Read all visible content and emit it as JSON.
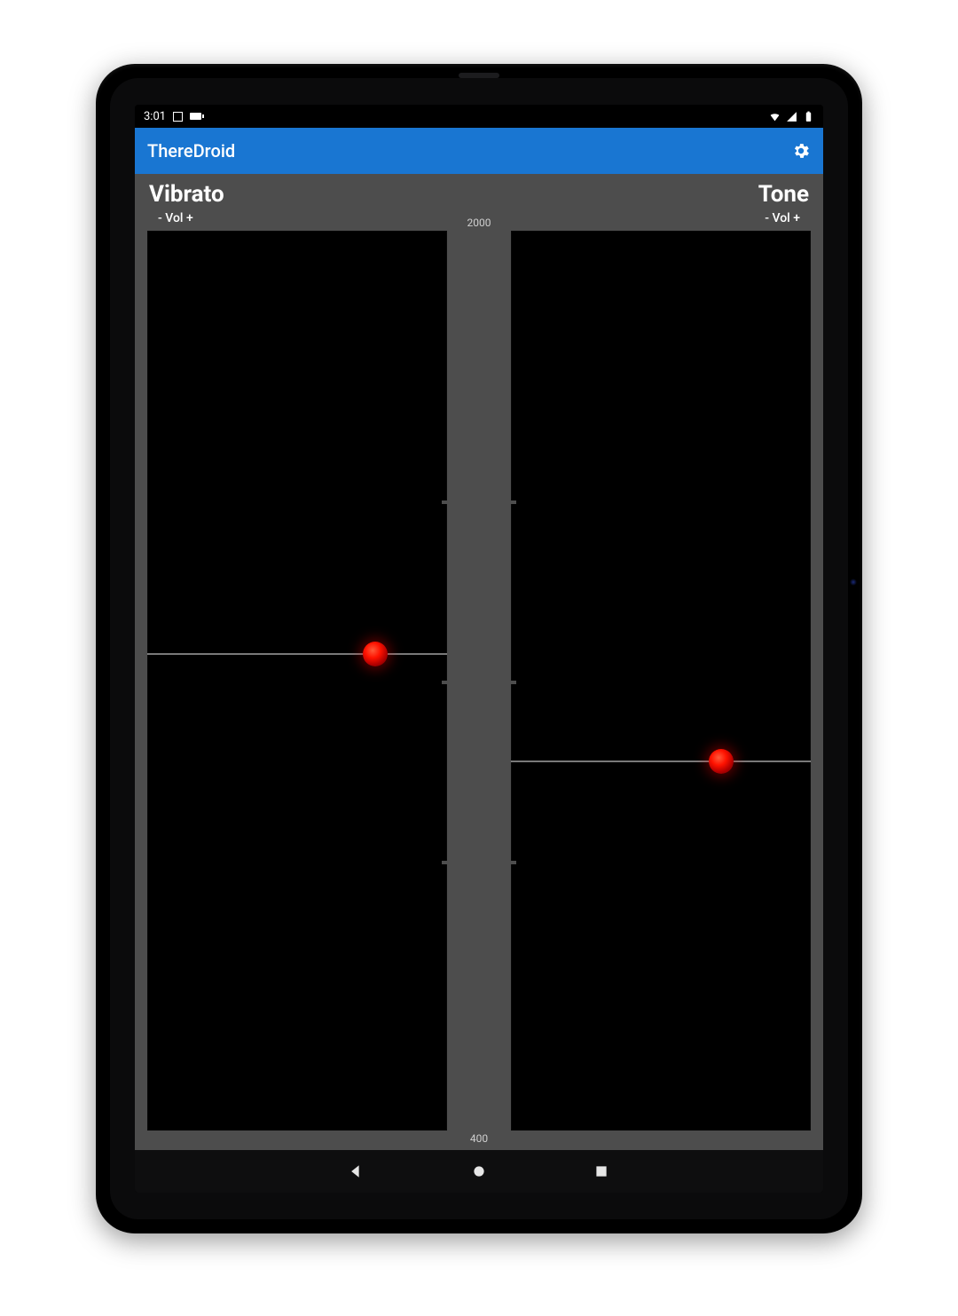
{
  "statusbar": {
    "time": "3:01"
  },
  "appbar": {
    "title": "ThereDroid"
  },
  "panels": {
    "left": {
      "title": "Vibrato",
      "sub": "- Vol +",
      "marker": {
        "x_pct": 76,
        "y_pct": 47
      }
    },
    "right": {
      "title": "Tone",
      "sub": "- Vol +",
      "marker": {
        "x_pct": 70,
        "y_pct": 59
      }
    }
  },
  "scale": {
    "max": "2000",
    "min": "400",
    "tick_pcts": [
      30,
      50,
      70
    ]
  }
}
